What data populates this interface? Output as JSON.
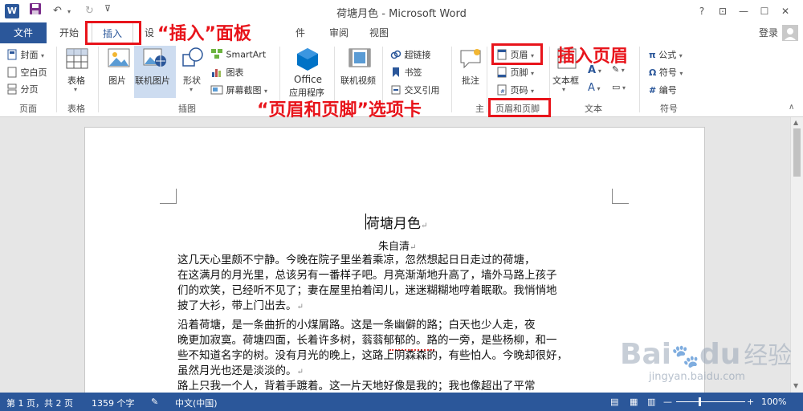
{
  "window": {
    "title": "荷塘月色 - Microsoft Word",
    "login": "登录",
    "help": "?",
    "buttons": {
      "restore_ribbon": "⊡",
      "minimize": "—",
      "maximize": "☐",
      "close": "✕"
    }
  },
  "tabs": {
    "file": "文件",
    "home": "开始",
    "insert": "插入",
    "design": "设",
    "layout_tail": "件",
    "review": "审阅",
    "view": "视图"
  },
  "ribbon": {
    "pages": {
      "cover": "封面",
      "blank": "空白页",
      "break": "分页",
      "group": "页面"
    },
    "tables": {
      "table": "表格",
      "group": "表格"
    },
    "illustrations": {
      "picture": "图片",
      "online_picture": "联机图片",
      "shapes": "形状",
      "smartart": "SmartArt",
      "chart": "图表",
      "screenshot": "屏幕截图",
      "group": "插图"
    },
    "apps": {
      "office_apps": "Office",
      "office_apps_2": "应用程序"
    },
    "media": {
      "online_video": "联机视频"
    },
    "links": {
      "hyperlink": "超链接",
      "bookmark": "书签",
      "cross_ref": "交叉引用",
      "group_tail": "主"
    },
    "comments": {
      "comment": "批注"
    },
    "header_footer": {
      "header": "页眉",
      "footer": "页脚",
      "page_number": "页码",
      "group": "页眉和页脚"
    },
    "text": {
      "textbox": "文本框",
      "group": "文本"
    },
    "symbols": {
      "equation": "公式",
      "symbol": "符号",
      "numbering": "编号",
      "group": "符号"
    }
  },
  "annotations": {
    "insert_panel": "“插入”面板",
    "insert_header": "插入页眉",
    "header_footer_tab": "“页眉和页脚”选项卡"
  },
  "document": {
    "title": "荷塘月色",
    "author": "朱自清",
    "lines": [
      "    这几天心里颇不宁静。今晚在院子里坐着乘凉，忽然想起日日走过的荷塘，",
      "在这满月的月光里，总该另有一番样子吧。月亮渐渐地升高了，墙外马路上孩子",
      "们的欢笑，已经听不见了；妻在屋里拍着闰儿，迷迷糊糊地哼着眠歌。我悄悄地",
      "披了大衫，带上门出去。",
      "    沿着荷塘，是一条曲折的小煤屑路。这是一条幽僻的路；白天也少人走，夜",
      "晚更加寂寞。荷塘四面，长着许多树，蓊蓊郁郁的。路的一旁，是些杨柳，和一",
      "些不知道名字的树。没有月光的晚上，这路上阴森森的，有些怕人。今晚却很好，",
      "虽然月光也还是淡淡的。",
      "    路上只我一个人，背着手踱着。这一片天地好像是我的；我也像超出了平常"
    ],
    "para_mark": "↵"
  },
  "statusbar": {
    "page": "第 1 页，共 2 页",
    "words": "1359 个字",
    "language": "中文(中国)",
    "zoom": "100%",
    "zoom_minus": "—",
    "zoom_plus": "+"
  },
  "watermark": {
    "brand": "Bai",
    "brand2": "du",
    "cn": "经验",
    "url": "jingyan.baidu.com"
  }
}
